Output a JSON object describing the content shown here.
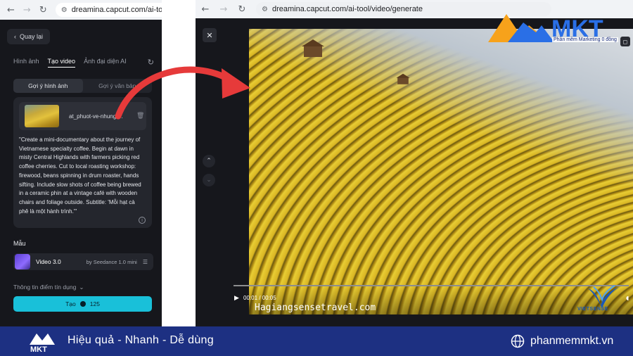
{
  "left_browser": {
    "url": "dreamina.capcut.com/ai-tool/video/"
  },
  "left_panel": {
    "back_label": "Quay lại",
    "tabs": [
      "Hình ảnh",
      "Tạo video",
      "Ảnh đại diện AI"
    ],
    "sub_tabs": [
      "Gợi ý hình ảnh",
      "Gợi ý văn bản"
    ],
    "file_name": "at_phuot-ve-nhung-...",
    "prompt_lines": [
      "\"Create a mini-documentary about the journey of",
      "Vietnamese specialty coffee. Begin at dawn in",
      "misty Central Highlands with farmers picking red",
      "coffee cherries. Cut to local roasting workshop:",
      "firewood, beans spinning in drum roaster, hands",
      "sifting. Include slow shots of coffee being brewed",
      "in a ceramic phin at a vintage café with wooden",
      "chairs and foliage outside. Subtitle: 'Mỗi hạt cà",
      "phê là một hành trình.'\""
    ],
    "section_label": "Mẫu",
    "model_name": "Video 3.0",
    "model_sub": "by Seedance 1.0 mini",
    "credit_info": "Thông tin điểm tín dụng",
    "create_label": "Tạo",
    "create_cost": "125"
  },
  "right_browser": {
    "url": "dreamina.capcut.com/ai-tool/video/generate"
  },
  "video": {
    "time": "00:01 / 00:05",
    "watermark": "Hagiangsensetravel.com",
    "logo_text": "VIETSENSE"
  },
  "brand": {
    "name": "MKT",
    "tagline": "Phần mềm Marketing 0 đồng"
  },
  "footer": {
    "slogan": "Hiệu quả - Nhanh - Dễ dùng",
    "website": "phanmemmkt.vn"
  },
  "icons": {
    "back": "chevron-left-icon",
    "forward": "arrow-right-icon",
    "reload": "reload-icon",
    "site_settings": "tune-icon",
    "refresh": "refresh-icon",
    "trash": "trash-icon",
    "info": "info-icon",
    "close": "close-icon",
    "play": "play-icon",
    "globe": "globe-icon"
  },
  "colors": {
    "panel_bg": "#16171c",
    "accent_cyan": "#19c0d9",
    "footer_blue": "#1d3082",
    "arrow_red": "#e63a3a",
    "brand_orange": "#f7a21b",
    "brand_blue": "#2a6fe6"
  }
}
